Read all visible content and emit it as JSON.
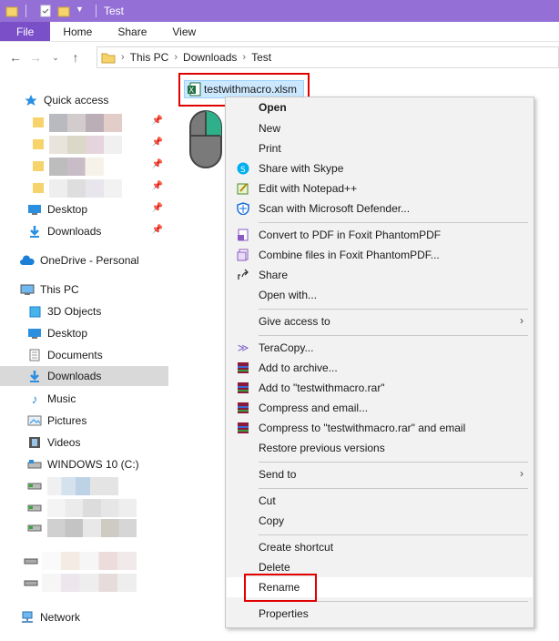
{
  "window": {
    "title": "Test"
  },
  "ribbon": {
    "tabs": [
      "File",
      "Home",
      "Share",
      "View"
    ]
  },
  "address": {
    "crumbs": [
      "This PC",
      "Downloads",
      "Test"
    ]
  },
  "sidebar": {
    "quick_access": "Quick access",
    "desktop": "Desktop",
    "downloads": "Downloads",
    "onedrive": "OneDrive - Personal",
    "this_pc": "This PC",
    "objects3d": "3D Objects",
    "desktop2": "Desktop",
    "documents": "Documents",
    "downloads2": "Downloads",
    "music": "Music",
    "pictures": "Pictures",
    "videos": "Videos",
    "drive_c": "WINDOWS 10 (C:)",
    "network": "Network"
  },
  "file": {
    "name": "testwithmacro.xlsm"
  },
  "menu": {
    "open": "Open",
    "new": "New",
    "print": "Print",
    "skype": "Share with Skype",
    "notepad": "Edit with Notepad++",
    "defender": "Scan with Microsoft Defender...",
    "foxit_pdf": "Convert to PDF in Foxit PhantomPDF",
    "foxit_combine": "Combine files in Foxit PhantomPDF...",
    "share": "Share",
    "open_with": "Open with...",
    "give_access": "Give access to",
    "teracopy": "TeraCopy...",
    "add_archive": "Add to archive...",
    "add_rar": "Add to \"testwithmacro.rar\"",
    "compress_email": "Compress and email...",
    "compress_rar_email": "Compress to \"testwithmacro.rar\" and email",
    "restore": "Restore previous versions",
    "send_to": "Send to",
    "cut": "Cut",
    "copy": "Copy",
    "create_shortcut": "Create shortcut",
    "delete": "Delete",
    "rename": "Rename",
    "properties": "Properties"
  },
  "colors": {
    "titlebar": "#9470d6",
    "file_tab": "#7b4fc8",
    "highlight": "#e00000",
    "selection": "#cce8ff"
  }
}
